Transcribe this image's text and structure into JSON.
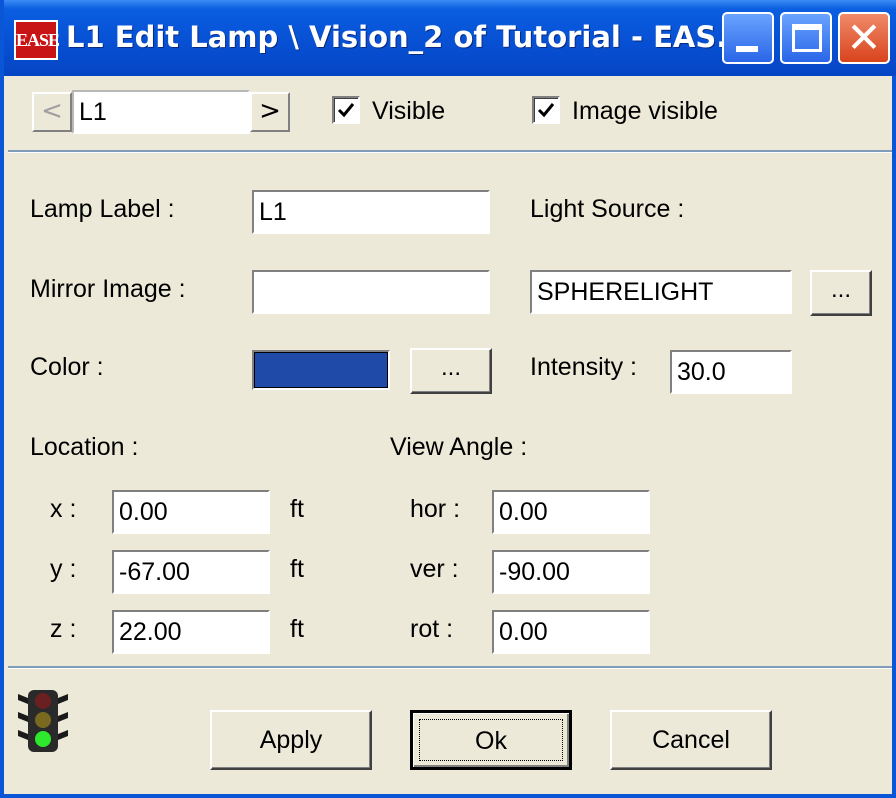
{
  "window": {
    "app_icon_text": "EASE",
    "title": "L1 Edit Lamp \\ Vision_2 of Tutorial - EAS...",
    "minimize_label": "Minimize",
    "maximize_label": "Maximize",
    "close_label": "Close"
  },
  "nav": {
    "prev_glyph": "<",
    "current_value": "L1",
    "next_glyph": ">",
    "visible_label": "Visible",
    "visible_checked": true,
    "image_visible_label": "Image visible",
    "image_visible_checked": true
  },
  "lamp": {
    "label_caption": "Lamp Label :",
    "label_value": "L1",
    "light_source_caption": "Light Source :",
    "mirror_caption": "Mirror Image :",
    "mirror_value": "",
    "light_source_value": "SPHERELIGHT",
    "light_source_browse": "...",
    "color_caption": "Color :",
    "color_value": "#1f4aa8",
    "color_browse": "...",
    "intensity_caption": "Intensity :",
    "intensity_value": "30.0"
  },
  "location": {
    "caption": "Location :",
    "x_label": "x :",
    "x_value": "0.00",
    "y_label": "y :",
    "y_value": "-67.00",
    "z_label": "z :",
    "z_value": "22.00",
    "unit": "ft"
  },
  "view_angle": {
    "caption": "View Angle :",
    "hor_label": "hor :",
    "hor_value": "0.00",
    "ver_label": "ver :",
    "ver_value": "-90.00",
    "rot_label": "rot :",
    "rot_value": "0.00"
  },
  "footer": {
    "status_icon": "traffic-light-icon",
    "apply_label": "Apply",
    "ok_label": "Ok",
    "cancel_label": "Cancel"
  }
}
